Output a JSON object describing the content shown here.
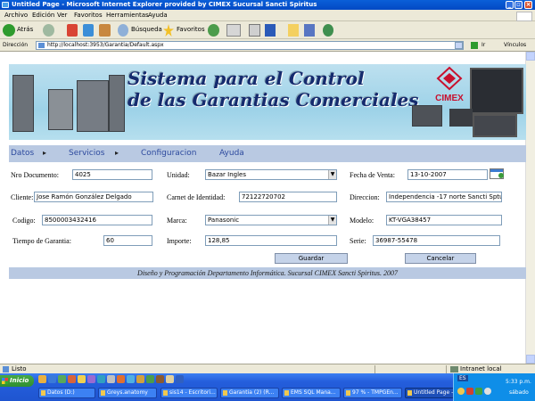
{
  "window": {
    "title": "Untitled Page - Microsoft Internet Explorer provided by CIMEX Sucursal Sancti Spiritus"
  },
  "menu": [
    "Archivo",
    "Edición",
    "Ver",
    "Favoritos",
    "Herramientas",
    "Ayuda"
  ],
  "toolbar": {
    "back_label": "Atrás",
    "search_label": "Búsqueda",
    "favorites_label": "Favoritos"
  },
  "address": {
    "label": "Dirección",
    "url": "http://localhost:3953/Garantia/Default.aspx",
    "go_label": "Ir",
    "links_label": "Vínculos"
  },
  "banner": {
    "line1": "Sistema para el Control",
    "line2": "de las Garantias Comerciales",
    "brand": "CIMEX",
    "colors": {
      "brand": "#c8102e",
      "title": "#152b6e"
    }
  },
  "nav": {
    "items": [
      "Datos",
      "Servicios",
      "Configuracion",
      "Ayuda"
    ]
  },
  "form": {
    "nro_documento": {
      "label": "Nro Documento:",
      "value": "4025"
    },
    "unidad": {
      "label": "Unidad:",
      "value": "Bazar Ingles"
    },
    "fecha_venta": {
      "label": "Fecha de Venta:",
      "value": "13-10-2007"
    },
    "cliente": {
      "label": "Cliente:",
      "value": "Jose Ramón González Delgado"
    },
    "carnet": {
      "label": "Carnet de Identidad:",
      "value": "72122720702"
    },
    "direccion": {
      "label": "Direccion:",
      "value": "Independencia -17 norte Sancti Sptus"
    },
    "codigo": {
      "label": "Codigo:",
      "value": "8500003432416"
    },
    "marca": {
      "label": "Marca:",
      "value": "Panasonic"
    },
    "modelo": {
      "label": "Modelo:",
      "value": "KT-VGA38457"
    },
    "tiempo_garantia": {
      "label": "Tiempo de Garantia:",
      "value": "60"
    },
    "importe": {
      "label": "Importe:",
      "value": "128,85"
    },
    "serie": {
      "label": "Serie:",
      "value": "36987-55478"
    },
    "save_label": "Guardar",
    "cancel_label": "Cancelar"
  },
  "footer": "Diseño y Programación Departamento Informática. Sucursal CIMEX Sancti Spiritus. 2007",
  "status": {
    "text": "Listo",
    "zone": "Intranet local"
  },
  "taskbar": {
    "start_label": "Inicio",
    "tasks": [
      {
        "label": "Datos (D:)",
        "active": false
      },
      {
        "label": "Greys.anatomy",
        "active": false
      },
      {
        "label": "sis14 - Escritori...",
        "active": false
      },
      {
        "label": "Garantia (2) (R...",
        "active": false
      },
      {
        "label": "EMS SQL Mana...",
        "active": false
      },
      {
        "label": "97 % - TMPGEn...",
        "active": false
      },
      {
        "label": "Untitled Page -...",
        "active": true
      }
    ],
    "lang": "ES",
    "time": "5:33 p.m.",
    "day": "sábado"
  }
}
